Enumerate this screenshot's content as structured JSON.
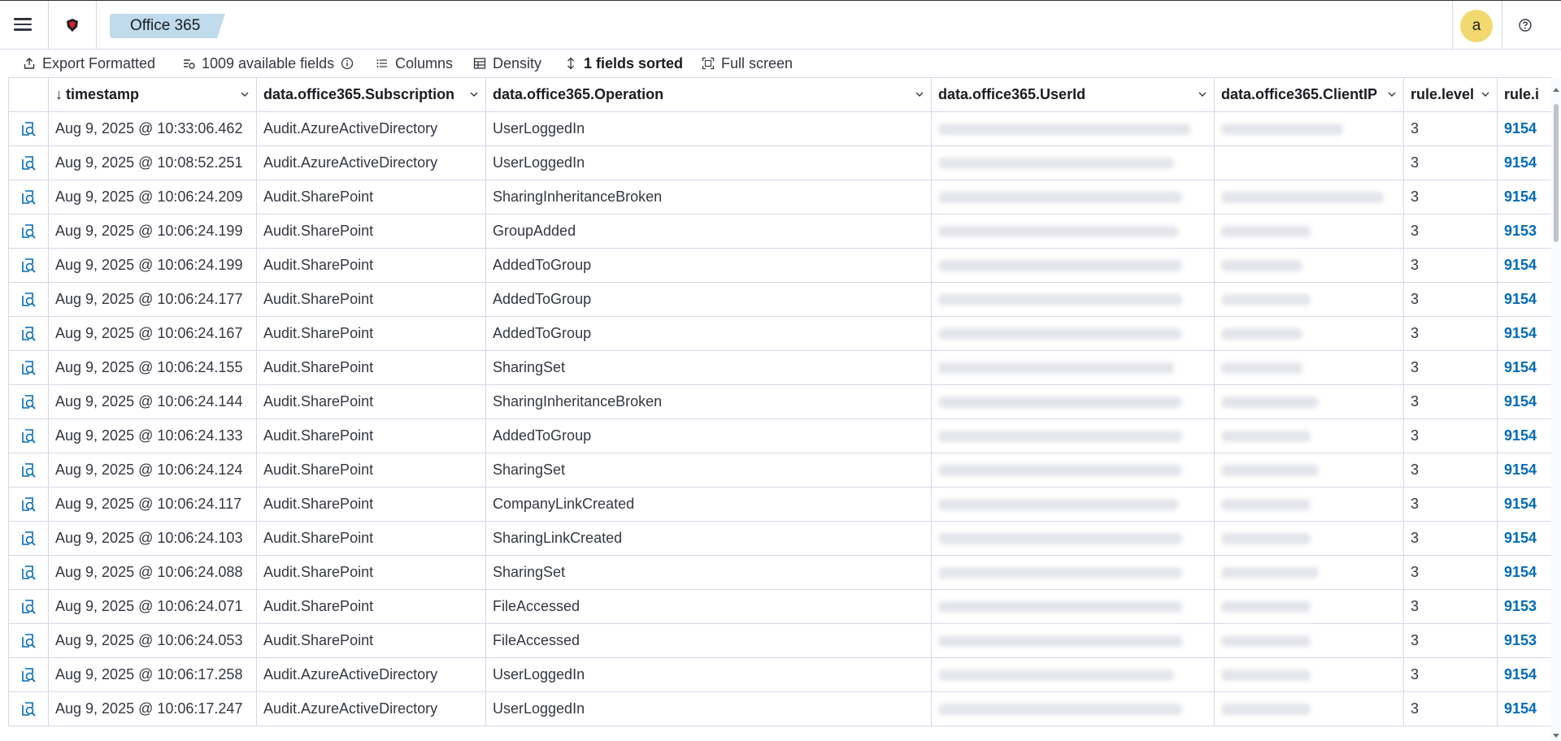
{
  "header": {
    "menu_icon": "hamburger-icon",
    "logo_icon": "shield-logo-icon",
    "breadcrumb": "Office 365",
    "avatar_letter": "a",
    "help_icon": "help-icon"
  },
  "toolbar": {
    "export_label": "Export Formatted",
    "fields_label": "1009 available fields",
    "columns_label": "Columns",
    "density_label": "Density",
    "sorted_label": "1 fields sorted",
    "fullscreen_label": "Full screen"
  },
  "table": {
    "columns": [
      "timestamp",
      "data.office365.Subscription",
      "data.office365.Operation",
      "data.office365.UserId",
      "data.office365.ClientIP",
      "rule.level",
      "rule.i"
    ],
    "rows": [
      {
        "timestamp": "Aug 9, 2025 @ 10:33:06.462",
        "subscription": "Audit.AzureActiveDirectory",
        "operation": "UserLoggedIn",
        "level": "3",
        "rule_id": "9154"
      },
      {
        "timestamp": "Aug 9, 2025 @ 10:08:52.251",
        "subscription": "Audit.AzureActiveDirectory",
        "operation": "UserLoggedIn",
        "level": "3",
        "rule_id": "9154"
      },
      {
        "timestamp": "Aug 9, 2025 @ 10:06:24.209",
        "subscription": "Audit.SharePoint",
        "operation": "SharingInheritanceBroken",
        "level": "3",
        "rule_id": "9154"
      },
      {
        "timestamp": "Aug 9, 2025 @ 10:06:24.199",
        "subscription": "Audit.SharePoint",
        "operation": "GroupAdded",
        "level": "3",
        "rule_id": "9153"
      },
      {
        "timestamp": "Aug 9, 2025 @ 10:06:24.199",
        "subscription": "Audit.SharePoint",
        "operation": "AddedToGroup",
        "level": "3",
        "rule_id": "9154"
      },
      {
        "timestamp": "Aug 9, 2025 @ 10:06:24.177",
        "subscription": "Audit.SharePoint",
        "operation": "AddedToGroup",
        "level": "3",
        "rule_id": "9154"
      },
      {
        "timestamp": "Aug 9, 2025 @ 10:06:24.167",
        "subscription": "Audit.SharePoint",
        "operation": "AddedToGroup",
        "level": "3",
        "rule_id": "9154"
      },
      {
        "timestamp": "Aug 9, 2025 @ 10:06:24.155",
        "subscription": "Audit.SharePoint",
        "operation": "SharingSet",
        "level": "3",
        "rule_id": "9154"
      },
      {
        "timestamp": "Aug 9, 2025 @ 10:06:24.144",
        "subscription": "Audit.SharePoint",
        "operation": "SharingInheritanceBroken",
        "level": "3",
        "rule_id": "9154"
      },
      {
        "timestamp": "Aug 9, 2025 @ 10:06:24.133",
        "subscription": "Audit.SharePoint",
        "operation": "AddedToGroup",
        "level": "3",
        "rule_id": "9154"
      },
      {
        "timestamp": "Aug 9, 2025 @ 10:06:24.124",
        "subscription": "Audit.SharePoint",
        "operation": "SharingSet",
        "level": "3",
        "rule_id": "9154"
      },
      {
        "timestamp": "Aug 9, 2025 @ 10:06:24.117",
        "subscription": "Audit.SharePoint",
        "operation": "CompanyLinkCreated",
        "level": "3",
        "rule_id": "9154"
      },
      {
        "timestamp": "Aug 9, 2025 @ 10:06:24.103",
        "subscription": "Audit.SharePoint",
        "operation": "SharingLinkCreated",
        "level": "3",
        "rule_id": "9154"
      },
      {
        "timestamp": "Aug 9, 2025 @ 10:06:24.088",
        "subscription": "Audit.SharePoint",
        "operation": "SharingSet",
        "level": "3",
        "rule_id": "9154"
      },
      {
        "timestamp": "Aug 9, 2025 @ 10:06:24.071",
        "subscription": "Audit.SharePoint",
        "operation": "FileAccessed",
        "level": "3",
        "rule_id": "9153"
      },
      {
        "timestamp": "Aug 9, 2025 @ 10:06:24.053",
        "subscription": "Audit.SharePoint",
        "operation": "FileAccessed",
        "level": "3",
        "rule_id": "9153"
      },
      {
        "timestamp": "Aug 9, 2025 @ 10:06:17.258",
        "subscription": "Audit.AzureActiveDirectory",
        "operation": "UserLoggedIn",
        "level": "3",
        "rule_id": "9154"
      },
      {
        "timestamp": "Aug 9, 2025 @ 10:06:17.247",
        "subscription": "Audit.AzureActiveDirectory",
        "operation": "UserLoggedIn",
        "level": "3",
        "rule_id": "9154"
      }
    ]
  },
  "colors": {
    "accent": "#006bb8",
    "breadcrumb_bg": "#bfdbec",
    "avatar_bg": "#f1d86f",
    "border": "#d3dae6"
  }
}
